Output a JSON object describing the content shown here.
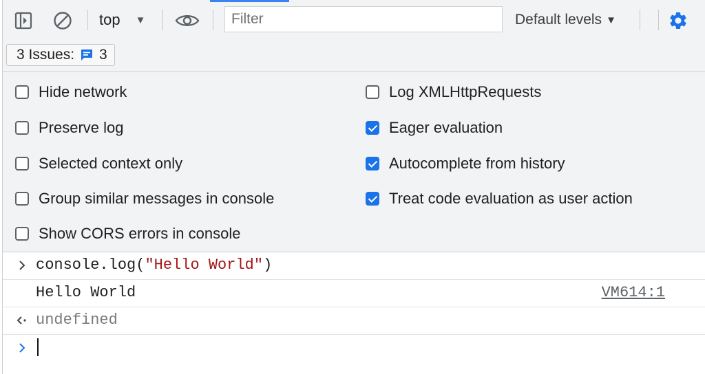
{
  "toolbar": {
    "context": "top",
    "filter_placeholder": "Filter",
    "default_levels": "Default levels",
    "accent_color": "#1a73e8"
  },
  "issues": {
    "label": "3 Issues:",
    "count": "3"
  },
  "settings": {
    "left": [
      {
        "label": "Hide network",
        "checked": false
      },
      {
        "label": "Preserve log",
        "checked": false
      },
      {
        "label": "Selected context only",
        "checked": false
      },
      {
        "label": "Group similar messages in console",
        "checked": false
      },
      {
        "label": "Show CORS errors in console",
        "checked": false
      }
    ],
    "right": [
      {
        "label": "Log XMLHttpRequests",
        "checked": false
      },
      {
        "label": "Eager evaluation",
        "checked": true
      },
      {
        "label": "Autocomplete from history",
        "checked": true
      },
      {
        "label": "Treat code evaluation as user action",
        "checked": true
      }
    ]
  },
  "console": {
    "input_prefix": "console.log(",
    "input_string": "\"Hello World\"",
    "input_suffix": ")",
    "output": "Hello World",
    "output_source": "VM614:1",
    "result": "undefined"
  }
}
